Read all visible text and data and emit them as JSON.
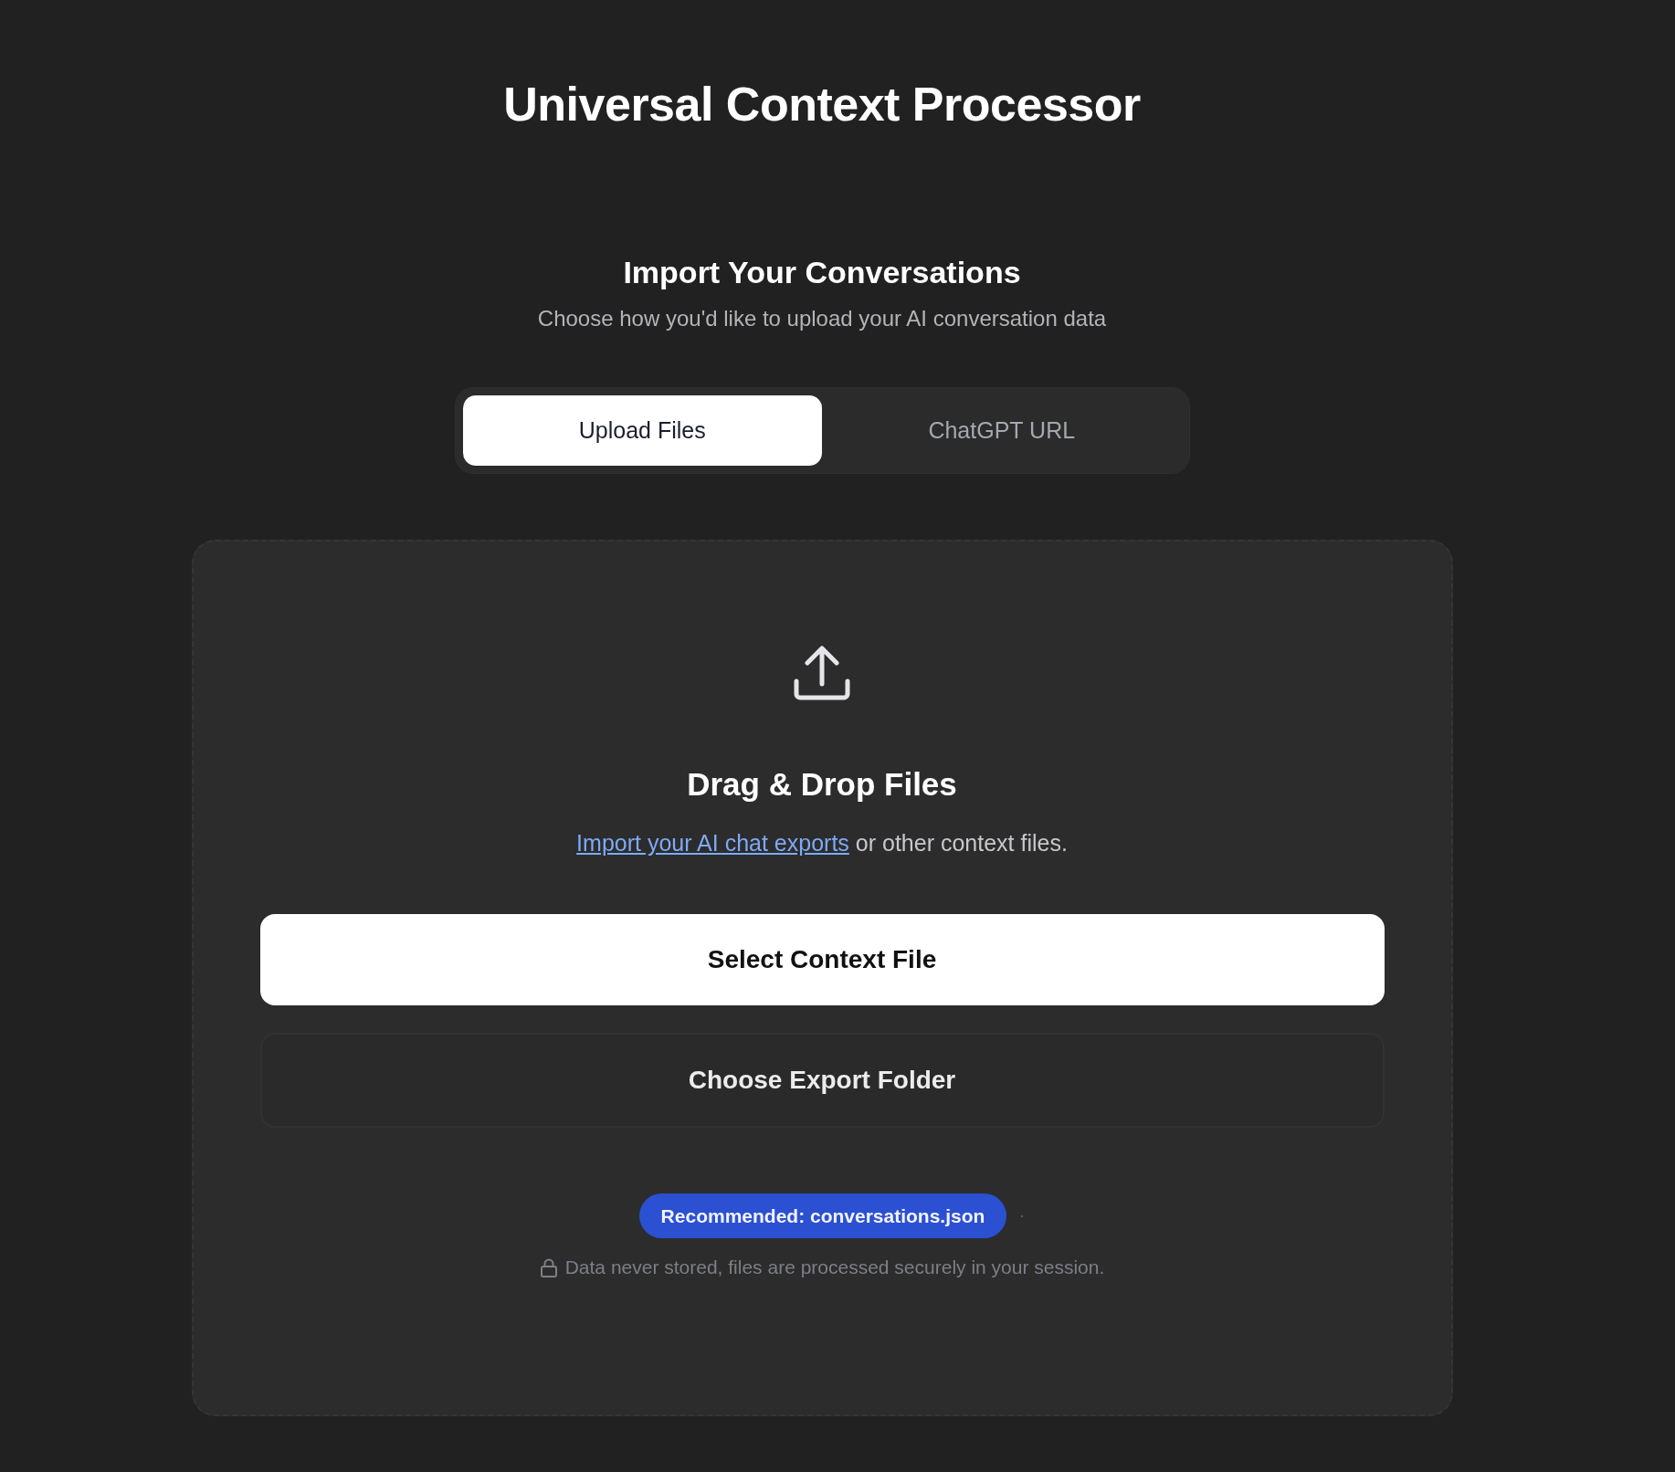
{
  "header": {
    "title": "Universal Context Processor"
  },
  "import": {
    "heading": "Import Your Conversations",
    "subtitle": "Choose how you'd like to upload your AI conversation data"
  },
  "tabs": [
    {
      "label": "Upload Files",
      "selected": true
    },
    {
      "label": "ChatGPT URL",
      "selected": false
    }
  ],
  "dropzone": {
    "heading": "Drag & Drop Files",
    "link": "Import your AI chat exports",
    "text": " or other context files.",
    "buttons": [
      {
        "label": "Select Context File",
        "kind": "primary"
      },
      {
        "label": "Choose Export Folder",
        "kind": "secondary"
      }
    ],
    "badge": "Recommended: conversations.json",
    "note": "Data never stored, files are processed securely in your session."
  }
}
